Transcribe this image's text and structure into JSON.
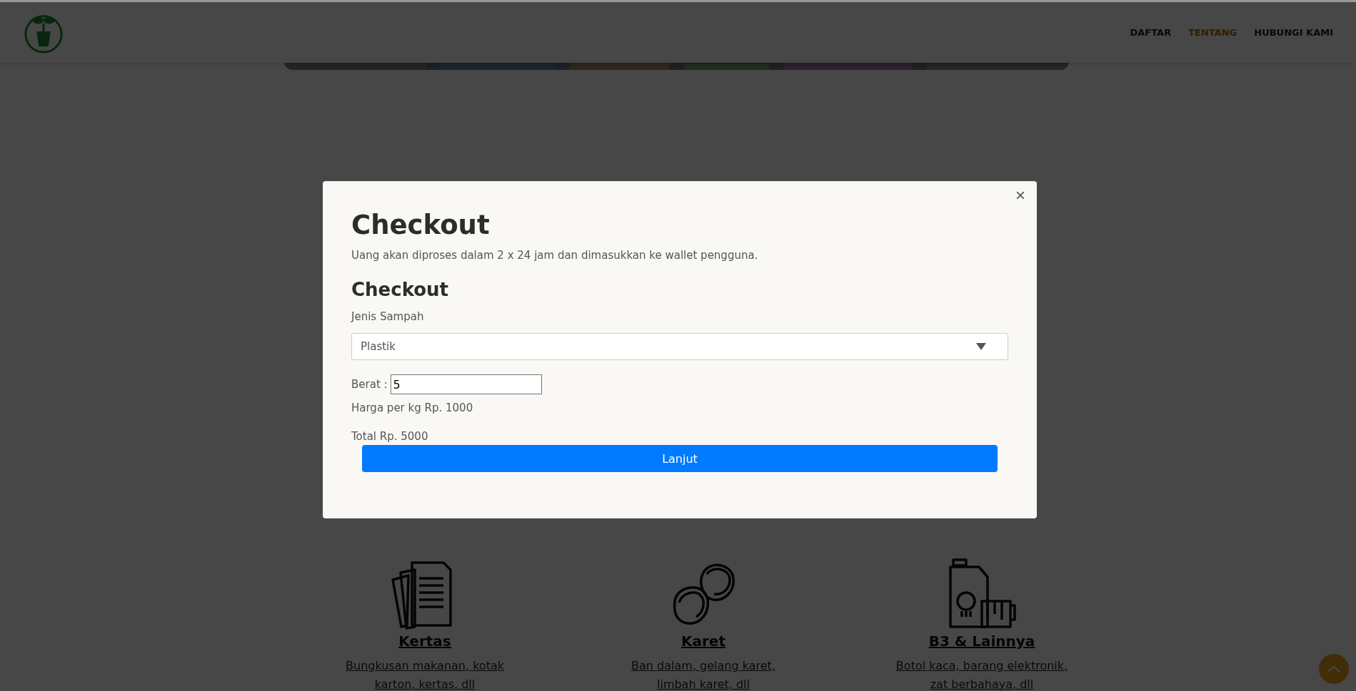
{
  "header": {
    "nav": [
      {
        "label": "DAFTAR",
        "selected": false
      },
      {
        "label": "TENTANG",
        "selected": true
      },
      {
        "label": "HUBUNGI KAMI",
        "selected": false
      }
    ]
  },
  "categories": [
    {
      "kind": "paper",
      "title": "Kertas",
      "description": "Bungkusan makanan, kotak karton, kertas, dll"
    },
    {
      "kind": "rubber",
      "title": "Karet",
      "description": "Ban dalam, gelang karet, limbah karet, dll"
    },
    {
      "kind": "hazard",
      "title": "B3 & Lainnya",
      "description": "Botol kaca, barang elektronik, zat berbahaya, dll"
    }
  ],
  "modal": {
    "close": "×",
    "title": "Checkout",
    "subtitle": "Uang akan diproses dalam 2 x 24 jam dan dimasukkan ke wallet pengguna.",
    "form_title": "Checkout",
    "type_label": "Jenis Sampah",
    "type_value": "Plastik",
    "weight_label": "Berat :",
    "weight_value": "5",
    "price_text": "Harga per kg Rp. 1000",
    "total_text": "Total Rp. 5000",
    "submit": "Lanjut"
  }
}
